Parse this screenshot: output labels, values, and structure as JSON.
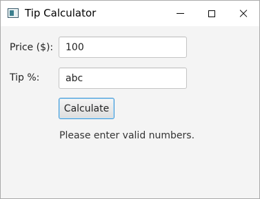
{
  "window": {
    "title": "Tip Calculator",
    "icon": "app-window-icon",
    "controls": [
      "minimize",
      "maximize",
      "close"
    ]
  },
  "form": {
    "price_label": "Price ($):",
    "price_value": "100",
    "tip_label": "Tip %:",
    "tip_value": "abc",
    "calculate_label": "Calculate",
    "message": "Please enter valid numbers."
  },
  "colors": {
    "window_bg": "#f4f4f4",
    "focus_border": "#3c95d4"
  }
}
